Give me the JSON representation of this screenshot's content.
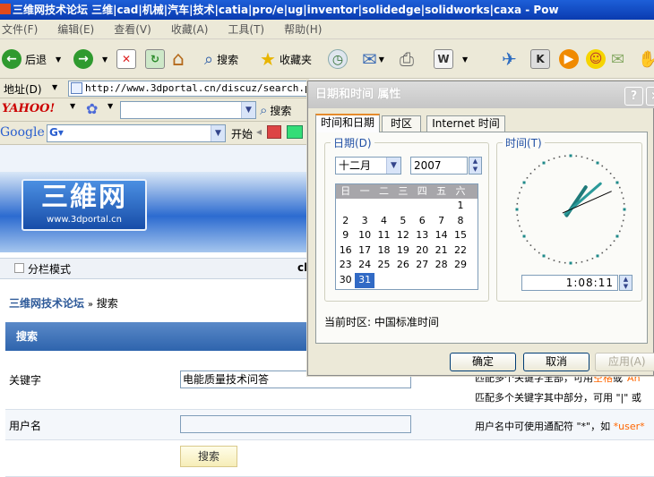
{
  "browser": {
    "title": "三维网技术论坛 三维|cad|机械|汽车|技术|catia|pro/e|ug|inventor|solidedge|solidworks|caxa - Pow",
    "menu": [
      "文件(F)",
      "编辑(E)",
      "查看(V)",
      "收藏(A)",
      "工具(T)",
      "帮助(H)"
    ],
    "toolbar": {
      "back": "后退",
      "search": "搜索",
      "favorites": "收藏夹"
    },
    "address_label": "地址(D)",
    "address": "http://www.3dportal.cn/discuz/search.php",
    "yahoo_logo": "YAHOO!",
    "yahoo_search": "搜索",
    "google_logo": "Google",
    "google_start": "开始"
  },
  "page": {
    "logo_text": "三維网",
    "logo_sub": "www.3dportal.cn",
    "split_mode": "分栏模式",
    "cl_fragment": "cl",
    "breadcrumb": {
      "home": "三维网技术论坛",
      "sep": "»",
      "current": "搜索"
    },
    "section_title": "搜索",
    "keyword_label": "关键字",
    "keyword_value": "电能质量技术问答",
    "username_label": "用户名",
    "username_value": "",
    "search_button": "搜索",
    "hint_line1_a": "匹配多个关键字全部，可用",
    "hint_line1_b": "空格",
    "hint_line1_c": "或",
    "hint_line1_d": "\"An",
    "hint_line2": "匹配多个关键字其中部分，可用 \"|\" 或",
    "hint_user_a": "用户名中可使用通配符 \"*\"，如",
    "hint_user_b": "*user*",
    "colors": {
      "hint_highlight": "#ff6600",
      "accent": "#2e64ad"
    }
  },
  "dialog": {
    "title": "日期和时间 属性",
    "help": "?",
    "close": "×",
    "tabs": [
      "时间和日期",
      "时区",
      "Internet 时间"
    ],
    "active_tab": 0,
    "date_group": "日期(D)",
    "month": "十二月",
    "year": "2007",
    "weekdays": [
      "日",
      "一",
      "二",
      "三",
      "四",
      "五",
      "六"
    ],
    "weeks": [
      [
        "",
        "",
        "",
        "",
        "",
        "",
        "1"
      ],
      [
        "2",
        "3",
        "4",
        "5",
        "6",
        "7",
        "8"
      ],
      [
        "9",
        "10",
        "11",
        "12",
        "13",
        "14",
        "15"
      ],
      [
        "16",
        "17",
        "18",
        "19",
        "20",
        "21",
        "22"
      ],
      [
        "23",
        "24",
        "25",
        "26",
        "27",
        "28",
        "29"
      ],
      [
        "30",
        "31",
        "",
        "",
        "",
        "",
        ""
      ]
    ],
    "selected_day": "31",
    "time_group": "时间(T)",
    "time": "1:08:11",
    "clock": {
      "hours": 1,
      "minutes": 8,
      "seconds": 11
    },
    "timezone": "当前时区: 中国标准时间",
    "ok": "确定",
    "cancel": "取消",
    "apply": "应用(A)"
  }
}
